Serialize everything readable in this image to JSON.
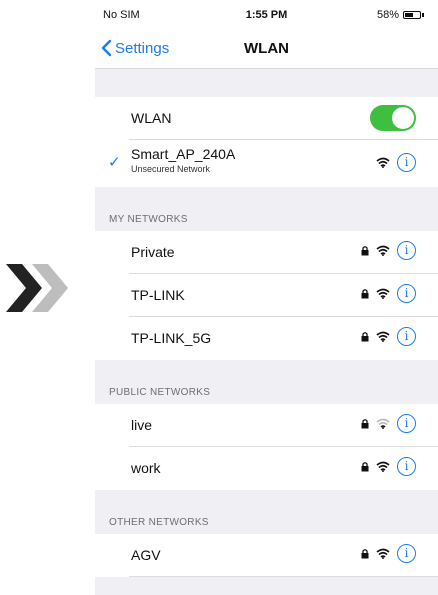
{
  "status_bar": {
    "carrier": "No SIM",
    "time": "1:55 PM",
    "battery": "58%",
    "battery_level": 0.58
  },
  "nav": {
    "back_label": "Settings",
    "title": "WLAN"
  },
  "wlan": {
    "label": "WLAN",
    "enabled": true,
    "toggle_color": "#3fbf3f"
  },
  "connected": {
    "name": "Smart_AP_240A",
    "security": "Unsecured Network"
  },
  "my_networks": {
    "header": "MY NETWORKS",
    "items": [
      {
        "name": "Private"
      },
      {
        "name": "TP-LINK"
      },
      {
        "name": "TP-LINK_5G"
      }
    ]
  },
  "public_networks": {
    "header": "PUBLIC NETWORKS",
    "items": [
      {
        "name": "live"
      },
      {
        "name": "work"
      }
    ]
  },
  "other_networks": {
    "header": "OTHER NETWORKS",
    "items": [
      {
        "name": "AGV"
      }
    ]
  },
  "colors": {
    "accent": "#1a7cf0",
    "background": "#efeff4"
  },
  "icons": {
    "lock": "lock-icon",
    "wifi": "wifi-icon",
    "info": "info-icon",
    "arrows": "double-chevron-right-icon"
  }
}
